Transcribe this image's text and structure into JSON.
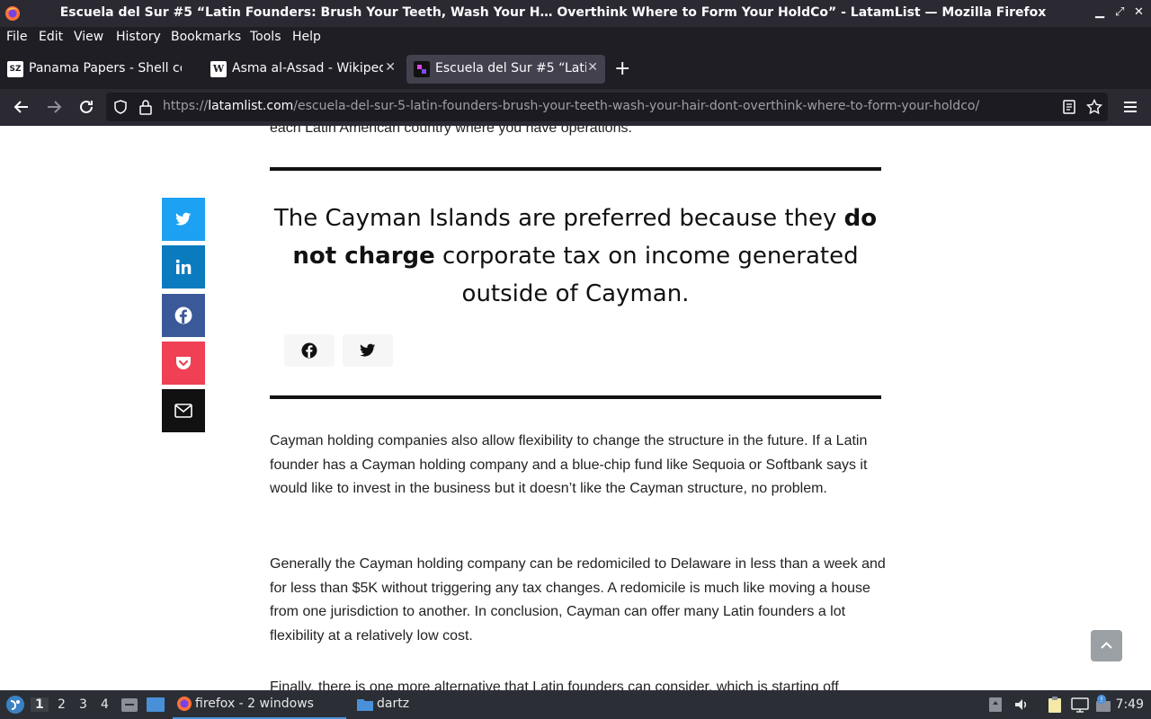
{
  "window": {
    "title": "Escuela del Sur #5 “Latin Founders: Brush Your Teeth, Wash Your H… Overthink Where to Form Your HoldCo” - LatamList — Mozilla Firefox"
  },
  "menu": [
    "File",
    "Edit",
    "View",
    "History",
    "Bookmarks",
    "Tools",
    "Help"
  ],
  "tabs": [
    {
      "label": "Panama Papers - Shell co",
      "favicon": "SZ"
    },
    {
      "label": "Asma al-Assad - Wikipedi",
      "favicon": "W"
    },
    {
      "label": "Escuela del Sur #5 “Latin",
      "favicon": ""
    }
  ],
  "url": {
    "prefix": "https://",
    "domain": "latamlist.com",
    "path": "/escuela-del-sur-5-latin-founders-brush-your-teeth-wash-your-hair-dont-overthink-where-to-form-your-holdco/"
  },
  "article": {
    "partial_top": "each Latin American country where you have operations.",
    "quote_pre": "The Cayman Islands are preferred because they ",
    "quote_bold": "do not charge",
    "quote_post": " corporate tax on income generated outside of Cayman.",
    "p1": "Cayman holding companies also allow flexibility to change the structure in the future.  If a Latin founder has a Cayman holding company and a blue-chip fund like Sequoia or Softbank says it would like to invest in the business but it doesn’t like the Cayman structure, no problem.",
    "p2": "Generally the Cayman holding company can be redomiciled to Delaware in less than a week and for less than $5K without triggering any tax changes. A redomicile is much like moving a house from one jurisdiction to another. In conclusion, Cayman can offer many Latin founders a lot flexibility at a relatively low cost.",
    "p3_partial": "Finally, there is one more alternative that Latin founders can consider, which is starting off"
  },
  "social_colors": {
    "twitter": "#1da1f2",
    "linkedin": "#0a7bbf",
    "facebook": "#3b5998",
    "pocket": "#ef4056",
    "email": "#111111"
  },
  "taskbar": {
    "workspaces": [
      "1",
      "2",
      "3",
      "4"
    ],
    "firefox_task": "firefox - 2 windows",
    "folder_task": "dartz",
    "clock": "7:49"
  }
}
